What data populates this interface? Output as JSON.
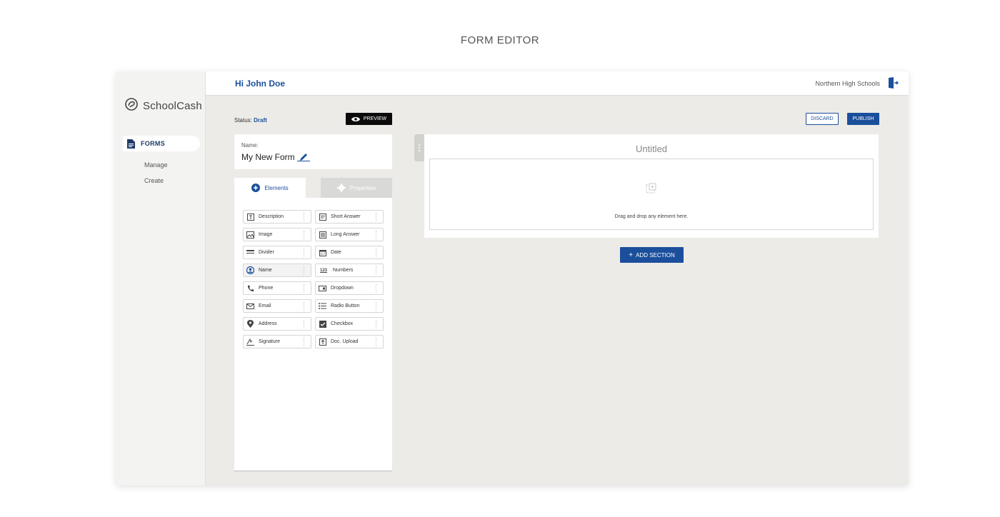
{
  "caption": "FORM EDITOR",
  "brand": {
    "name": "SchoolCash"
  },
  "sidebar": {
    "section_label": "FORMS",
    "items": [
      {
        "label": "Manage"
      },
      {
        "label": "Create"
      }
    ]
  },
  "header": {
    "greeting": "Hi John Doe",
    "organization": "Northern High Schools"
  },
  "toolbar": {
    "status_prefix": "Status: ",
    "status_value": "Draft",
    "preview_label": "PREVIEW",
    "discard_label": "DISCARD",
    "publish_label": "PUBLISH"
  },
  "form_name": {
    "label": "Name:",
    "value": "My New Form"
  },
  "tabs": {
    "elements": "Elements",
    "properties": "Properties"
  },
  "elements": [
    {
      "label": "Description",
      "icon": "text-box-icon"
    },
    {
      "label": "Short Answer",
      "icon": "short-answer-icon"
    },
    {
      "label": "Image",
      "icon": "image-icon"
    },
    {
      "label": "Long Answer",
      "icon": "long-answer-icon"
    },
    {
      "label": "Divider",
      "icon": "divider-icon"
    },
    {
      "label": "Date",
      "icon": "calendar-icon"
    },
    {
      "label": "Name",
      "icon": "user-circle-icon"
    },
    {
      "label": "Numbers",
      "icon": "numbers-icon"
    },
    {
      "label": "Phone",
      "icon": "phone-icon"
    },
    {
      "label": "Dropdown",
      "icon": "dropdown-icon"
    },
    {
      "label": "Email",
      "icon": "envelope-icon"
    },
    {
      "label": "Radio Button",
      "icon": "radio-list-icon"
    },
    {
      "label": "Address",
      "icon": "location-pin-icon"
    },
    {
      "label": "Checkbox",
      "icon": "checkbox-icon"
    },
    {
      "label": "Signature",
      "icon": "signature-icon"
    },
    {
      "label": "Doc. Upload",
      "icon": "upload-icon"
    }
  ],
  "canvas": {
    "title": "Untitled",
    "dropzone_text": "Drag and drop any element here.",
    "add_section_label": "ADD SECTION",
    "add_symbol": "+"
  },
  "colors": {
    "primary": "#1b4f9c",
    "background": "#ecebe8"
  }
}
